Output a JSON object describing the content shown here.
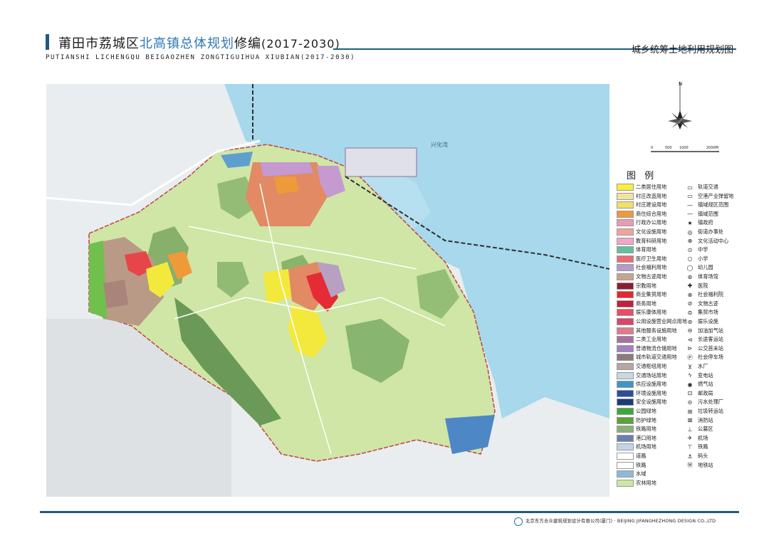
{
  "header": {
    "title_prefix": "莆田市荔城区",
    "title_highlight": "北高镇总体规划",
    "title_suffix": "修编",
    "title_years": "(2017-2030)",
    "subtitle": "PUTIANSHI LICHENGQU BEIGAOZHEN ZONGTIGUIHUA XIUBIAN(2017-2030)",
    "map_name": "城乡统筹土地利用规划图"
  },
  "map": {
    "water_label": "兴化湾",
    "scale_ticks": [
      "0",
      "500",
      "1000",
      "2000M"
    ]
  },
  "legend": {
    "title": "图 例",
    "left": [
      {
        "label": "二类居住用地",
        "color": "#f7ef3d"
      },
      {
        "label": "村庄改造用地",
        "color": "#f4e29e"
      },
      {
        "label": "村庄建设用地",
        "color": "#f2df6a"
      },
      {
        "label": "商住综合用地",
        "color": "#ef9a3a"
      },
      {
        "label": "行政办公用地",
        "color": "#e89bb5"
      },
      {
        "label": "文化设施用地",
        "color": "#f0a39a"
      },
      {
        "label": "教育科研用地",
        "color": "#f2a7c6"
      },
      {
        "label": "体育用地",
        "color": "#63c09b"
      },
      {
        "label": "医疗卫生用地",
        "color": "#e86c77"
      },
      {
        "label": "社会福利用地",
        "color": "#b59bc8"
      },
      {
        "label": "文物古迹用地",
        "color": "#c7a48f"
      },
      {
        "label": "宗教用地",
        "color": "#8a1e30"
      },
      {
        "label": "商业集贸用地",
        "color": "#e5262d"
      },
      {
        "label": "商务用地",
        "color": "#c41f3b"
      },
      {
        "label": "娱乐康体用地",
        "color": "#ee4b65"
      },
      {
        "label": "公用设施营业网点用地",
        "color": "#d8476a"
      },
      {
        "label": "其他服务设施用地",
        "color": "#e27a8e"
      },
      {
        "label": "二类工业用地",
        "color": "#a9719c"
      },
      {
        "label": "普通物流仓储用地",
        "color": "#a480c2"
      },
      {
        "label": "城市轨道交通用地",
        "color": "#8d7a7c"
      },
      {
        "label": "交通枢纽用地",
        "color": "#b7a6a7"
      },
      {
        "label": "交通场站用地",
        "color": "#c9d7e3"
      },
      {
        "label": "供应设施用地",
        "color": "#3e97c7"
      },
      {
        "label": "环境设施用地",
        "color": "#2a4f9c"
      },
      {
        "label": "安全设施用地",
        "color": "#1d3b7a"
      },
      {
        "label": "公园绿地",
        "color": "#3ca83b"
      },
      {
        "label": "防护绿地",
        "color": "#5aa33a"
      },
      {
        "label": "铁路用地",
        "color": "#8ab07a"
      },
      {
        "label": "港口用地",
        "color": "#6b7fb0"
      },
      {
        "label": "机场用地",
        "color": "#c1d4e6"
      },
      {
        "label": "道路",
        "color": "#ffffff"
      },
      {
        "label": "铁路",
        "color": "#ffffff"
      },
      {
        "label": "水域",
        "color": "#8fb8d6"
      },
      {
        "label": "农林用地",
        "color": "#cbe7a6"
      }
    ],
    "right": [
      {
        "label": "轨道交通",
        "icon": "rail-transit-icon",
        "glyph": "▭"
      },
      {
        "label": "空港产业弹留地",
        "icon": "airport-reserve-icon",
        "glyph": "▭"
      },
      {
        "label": "镇域规区范围",
        "icon": "planning-boundary-icon",
        "glyph": "—"
      },
      {
        "label": "镇域范围",
        "icon": "town-boundary-icon",
        "glyph": "—"
      },
      {
        "label": "镇政府",
        "icon": "town-government-icon",
        "glyph": "★"
      },
      {
        "label": "街道办事处",
        "icon": "street-office-icon",
        "glyph": "◎"
      },
      {
        "label": "文化活动中心",
        "icon": "culture-center-icon",
        "glyph": "⊕"
      },
      {
        "label": "中学",
        "icon": "middle-school-icon",
        "glyph": "⊙"
      },
      {
        "label": "小学",
        "icon": "primary-school-icon",
        "glyph": "○"
      },
      {
        "label": "幼儿园",
        "icon": "kindergarten-icon",
        "glyph": "◯"
      },
      {
        "label": "体育场馆",
        "icon": "stadium-icon",
        "glyph": "⊛"
      },
      {
        "label": "医院",
        "icon": "hospital-icon",
        "glyph": "✚"
      },
      {
        "label": "社会福利院",
        "icon": "welfare-home-icon",
        "glyph": "⊗"
      },
      {
        "label": "文物古迹",
        "icon": "heritage-icon",
        "glyph": "⊘"
      },
      {
        "label": "集贸市场",
        "icon": "market-icon",
        "glyph": "⊜"
      },
      {
        "label": "娱乐设施",
        "icon": "entertainment-icon",
        "glyph": "⊚"
      },
      {
        "label": "加油加气站",
        "icon": "gas-station-icon",
        "glyph": "⊖"
      },
      {
        "label": "长途客运站",
        "icon": "bus-terminal-icon",
        "glyph": "⊲"
      },
      {
        "label": "公交首末站",
        "icon": "bus-stop-icon",
        "glyph": "⊳"
      },
      {
        "label": "社会停车场",
        "icon": "parking-icon",
        "glyph": "Ⓟ"
      },
      {
        "label": "水厂",
        "icon": "waterworks-icon",
        "glyph": "⊻"
      },
      {
        "label": "变电站",
        "icon": "substation-icon",
        "glyph": "ϟ"
      },
      {
        "label": "燃气站",
        "icon": "gas-works-icon",
        "glyph": "◉"
      },
      {
        "label": "邮政局",
        "icon": "post-office-icon",
        "glyph": "⊡"
      },
      {
        "label": "污水处理厂",
        "icon": "sewage-plant-icon",
        "glyph": "⊝"
      },
      {
        "label": "垃圾转运站",
        "icon": "waste-transfer-icon",
        "glyph": "⊞"
      },
      {
        "label": "消防站",
        "icon": "fire-station-icon",
        "glyph": "⊠"
      },
      {
        "label": "公墓区",
        "icon": "cemetery-icon",
        "glyph": "⊥"
      },
      {
        "label": "机场",
        "icon": "airport-icon",
        "glyph": "✈"
      },
      {
        "label": "铁路",
        "icon": "railway-station-icon",
        "glyph": "⊤"
      },
      {
        "label": "码头",
        "icon": "wharf-icon",
        "glyph": "⚓"
      },
      {
        "label": "地铁站",
        "icon": "metro-station-icon",
        "glyph": "Ⓜ"
      }
    ]
  },
  "footer": {
    "company": "北京东方合众建筑规划设计有限公司(厦门)  ·  BEIJING JIFANGHEZHONG DESIGN CO.,LTD"
  }
}
